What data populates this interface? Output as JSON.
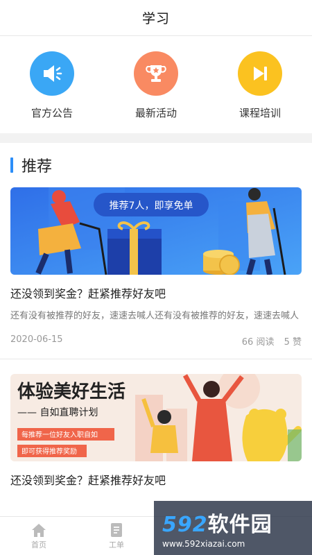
{
  "header": {
    "title": "学习"
  },
  "quick_actions": [
    {
      "label": "官方公告",
      "icon": "megaphone-icon",
      "color": "#3aa7f5"
    },
    {
      "label": "最新活动",
      "icon": "trophy-icon",
      "color": "#f98a62"
    },
    {
      "label": "课程培训",
      "icon": "play-next-icon",
      "color": "#fbc220"
    }
  ],
  "section": {
    "title": "推荐"
  },
  "articles": [
    {
      "banner_text": "推荐7人，即享免单",
      "title": "还没领到奖金？赶紧推荐好友吧",
      "desc": "还有没有被推荐的好友，速速去喊人还有没有被推荐的好友，速速去喊人",
      "date": "2020-06-15",
      "reads": "66 阅读",
      "likes": "5 赞"
    },
    {
      "banner_headline": "体验美好生活",
      "banner_sub": "—— 自如直聘计划",
      "banner_tag1": "每推荐一位好友入职自如",
      "banner_tag2": "即可获得推荐奖励",
      "title": "还没领到奖金？赶紧推荐好友吧"
    }
  ],
  "tabbar": [
    {
      "label": "首页",
      "icon": "home-icon"
    },
    {
      "label": "工单",
      "icon": "document-icon"
    }
  ],
  "watermark": {
    "num": "592",
    "text": "软件园",
    "url": "www.592xiazai.com"
  }
}
